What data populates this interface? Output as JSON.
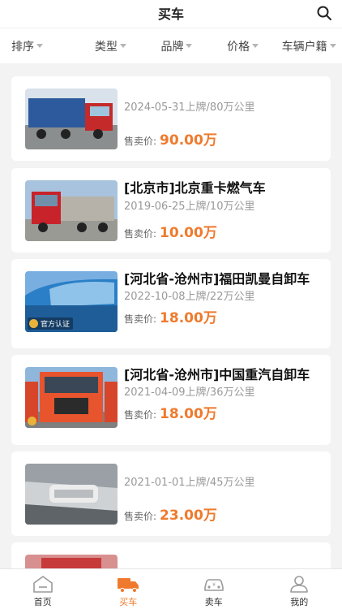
{
  "header": {
    "title": "买车",
    "search_icon": "search-icon"
  },
  "filters": [
    {
      "label": "排序"
    },
    {
      "label": "类型"
    },
    {
      "label": "品牌"
    },
    {
      "label": "价格"
    },
    {
      "label": "车辆户籍"
    }
  ],
  "listings": [
    {
      "title": "",
      "meta": "2024-05-31上牌/80万公里",
      "price_label": "售卖价:",
      "price": "90.00万",
      "certified": ""
    },
    {
      "title": "[北京市]北京重卡燃气车",
      "meta": "2019-06-25上牌/10万公里",
      "price_label": "售卖价:",
      "price": "10.00万",
      "certified": ""
    },
    {
      "title": "[河北省-沧州市]福田凯曼自卸车",
      "meta": "2022-10-08上牌/22万公里",
      "price_label": "售卖价:",
      "price": "18.00万",
      "certified": "官方认证"
    },
    {
      "title": "[河北省-沧州市]中国重汽自卸车",
      "meta": "2021-04-09上牌/36万公里",
      "price_label": "售卖价:",
      "price": "18.00万",
      "certified": ""
    },
    {
      "title": "",
      "meta": "2021-01-01上牌/45万公里",
      "price_label": "售卖价:",
      "price": "23.00万",
      "certified": ""
    }
  ],
  "tabbar": [
    {
      "label": "首页",
      "icon": "home-icon"
    },
    {
      "label": "买车",
      "icon": "truck-icon",
      "active": true
    },
    {
      "label": "卖车",
      "icon": "car-sell-icon"
    },
    {
      "label": "我的",
      "icon": "user-icon"
    }
  ],
  "colors": {
    "accent": "#ef7a2d",
    "background": "#f3f3f3"
  }
}
